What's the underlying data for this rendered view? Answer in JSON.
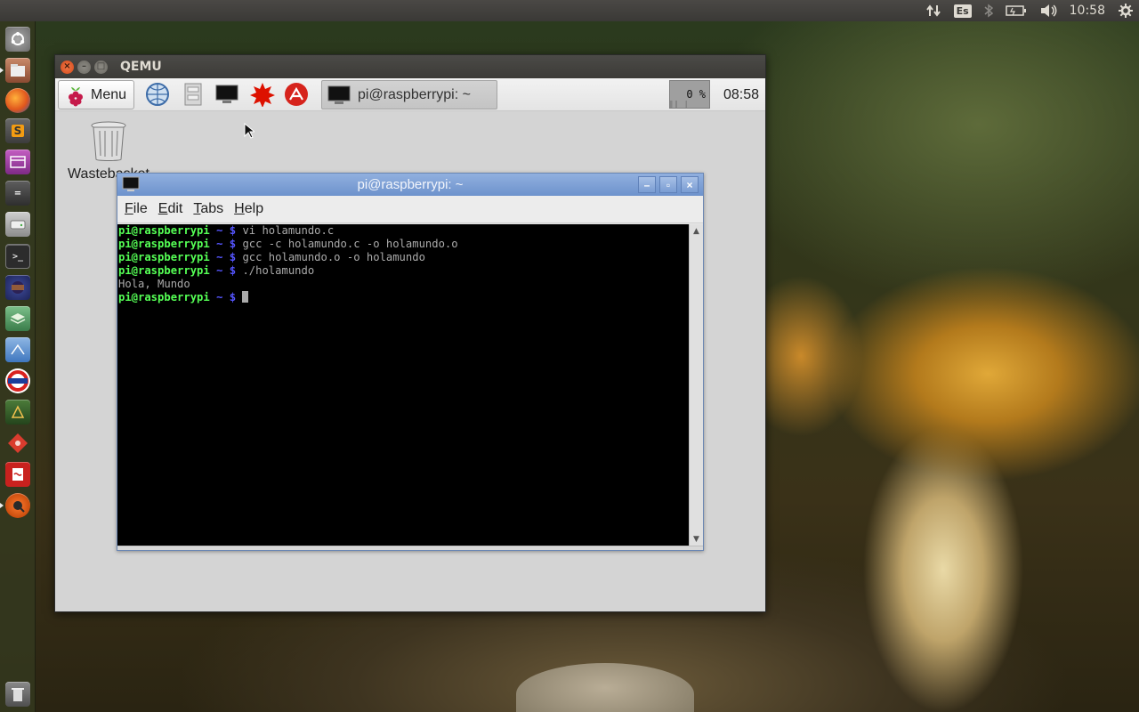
{
  "host": {
    "top_panel": {
      "keyboard_layout": "Es",
      "clock": "10:58",
      "indicators": [
        "network-icon",
        "keyboard-layout-icon",
        "bluetooth-icon",
        "battery-icon",
        "volume-icon",
        "settings-gear-icon"
      ]
    },
    "launcher": {
      "items": [
        "ubuntu-dash-icon",
        "files-app-icon",
        "firefox-icon",
        "sublime-text-icon",
        "app-icon",
        "terminal-app-icon",
        "disk-icon",
        "terminal-icon",
        "eclipse-icon",
        "stack-app-icon",
        "qt-app-icon",
        "app-red-icon",
        "app-green-icon",
        "app-red-diamond-icon",
        "app-pdf-icon",
        "qemu-icon",
        "trash-icon"
      ]
    }
  },
  "qemu_window": {
    "title": "QEMU"
  },
  "guest": {
    "panel": {
      "menu_label": "Menu",
      "launchers": [
        "browser-icon",
        "file-manager-icon",
        "terminal-icon",
        "wolfram-icon",
        "mathematica-icon"
      ],
      "task_label": "pi@raspberrypi: ~",
      "cpu_usage": "0 %",
      "clock": "08:58"
    },
    "desktop": {
      "trash_label": "Wastebasket"
    },
    "terminal": {
      "title": "pi@raspberrypi: ~",
      "menu": [
        "File",
        "Edit",
        "Tabs",
        "Help"
      ],
      "prompt_user": "pi@raspberrypi",
      "prompt_path": "~",
      "prompt_symbol": "$",
      "lines": [
        {
          "type": "cmd",
          "text": "vi holamundo.c"
        },
        {
          "type": "cmd",
          "text": "gcc -c holamundo.c -o holamundo.o"
        },
        {
          "type": "cmd",
          "text": "gcc holamundo.o -o holamundo"
        },
        {
          "type": "cmd",
          "text": "./holamundo"
        },
        {
          "type": "out",
          "text": "Hola, Mundo"
        },
        {
          "type": "prompt",
          "text": ""
        }
      ]
    }
  },
  "colors": {
    "prompt_user": "#55ff55",
    "prompt_path": "#5555ff",
    "terminal_bg": "#000000",
    "terminal_fg": "#aaaaaa",
    "lxterm_title": "#7fa1d6"
  }
}
